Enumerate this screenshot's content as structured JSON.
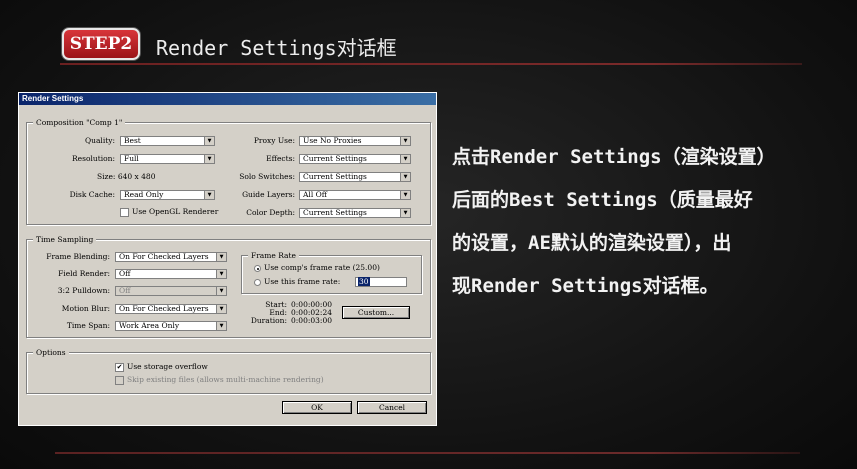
{
  "header": {
    "badge": "STEP2",
    "title": "Render Settings对话框"
  },
  "dialog": {
    "title": "Render Settings",
    "composition": {
      "legend": "Composition \"Comp 1\"",
      "quality_label": "Quality:",
      "quality_value": "Best",
      "resolution_label": "Resolution:",
      "resolution_value": "Full",
      "size_text": "Size: 640 x 480",
      "disk_cache_label": "Disk Cache:",
      "disk_cache_value": "Read Only",
      "opengl_label": "Use OpenGL Renderer",
      "proxy_use_label": "Proxy Use:",
      "proxy_use_value": "Use No Proxies",
      "effects_label": "Effects:",
      "effects_value": "Current Settings",
      "solo_label": "Solo Switches:",
      "solo_value": "Current Settings",
      "guide_label": "Guide Layers:",
      "guide_value": "All Off",
      "color_depth_label": "Color Depth:",
      "color_depth_value": "Current Settings"
    },
    "time_sampling": {
      "legend": "Time Sampling",
      "frame_blending_label": "Frame Blending:",
      "frame_blending_value": "On For Checked Layers",
      "field_render_label": "Field Render:",
      "field_render_value": "Off",
      "pulldown_label": "3:2 Pulldown:",
      "pulldown_value": "Off",
      "motion_blur_label": "Motion Blur:",
      "motion_blur_value": "On For Checked Layers",
      "time_span_label": "Time Span:",
      "time_span_value": "Work Area Only",
      "frame_rate_legend": "Frame Rate",
      "use_comp_rate": "Use comp's frame rate (25.00)",
      "use_this_rate": "Use this frame rate:",
      "rate_value": "30",
      "start_label": "Start:",
      "start_value": "0:00:00:00",
      "end_label": "End:",
      "end_value": "0:00:02:24",
      "duration_label": "Duration:",
      "duration_value": "0:00:03:00",
      "custom_button": "Custom..."
    },
    "options": {
      "legend": "Options",
      "storage_overflow": "Use storage overflow",
      "skip_existing": "Skip existing files (allows multi-machine rendering)"
    },
    "ok_button": "OK",
    "cancel_button": "Cancel"
  },
  "description": {
    "line1": "点击Render Settings（渲染设置）",
    "line2": "后面的Best Settings（质量最好",
    "line3": "的设置，AE默认的渲染设置），出",
    "line4": "现Render Settings对话框。"
  },
  "colors": {
    "badge": "#c0272d",
    "titlebar": "#0a246a",
    "dialog_bg": "#d4d0c8"
  }
}
